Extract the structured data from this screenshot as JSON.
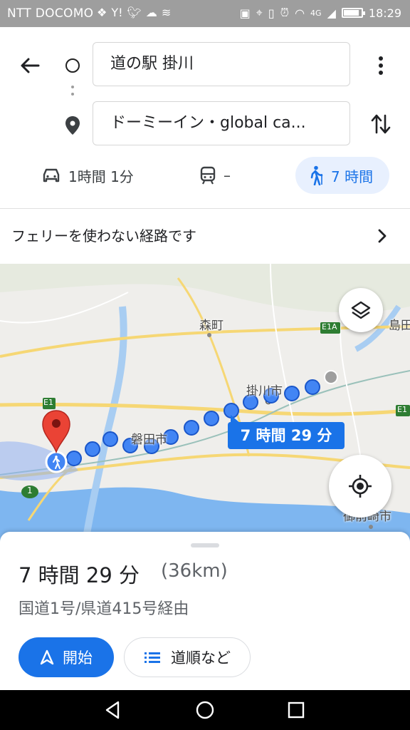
{
  "status_bar": {
    "carrier": "NTT DOCOMO",
    "network": "4G",
    "time": "18:29"
  },
  "directions": {
    "origin": "道の駅 掛川",
    "destination": "ドーミーイン・global ca..."
  },
  "travel_modes": [
    {
      "mode": "car",
      "icon": "car-icon",
      "label": "1時間 1分"
    },
    {
      "mode": "transit",
      "icon": "train-icon",
      "label": "–"
    },
    {
      "mode": "walk",
      "icon": "walk-icon",
      "label": "7 時間",
      "selected": true
    }
  ],
  "notice": {
    "text": "フェリーを使わない経路です"
  },
  "map": {
    "labels": [
      "森町",
      "掛川市",
      "磐田市",
      "島田",
      "御前崎市",
      "E1A",
      "E1",
      "E1",
      "1"
    ],
    "route_bubble": "7 時間 29 分",
    "route_color": "#4285f4",
    "accent": "#1a73e8"
  },
  "sheet": {
    "duration": "7 時間 29 分",
    "distance": "(36km)",
    "via": "国道1号/県道415号経由",
    "start_label": "開始",
    "steps_label": "道順など"
  }
}
